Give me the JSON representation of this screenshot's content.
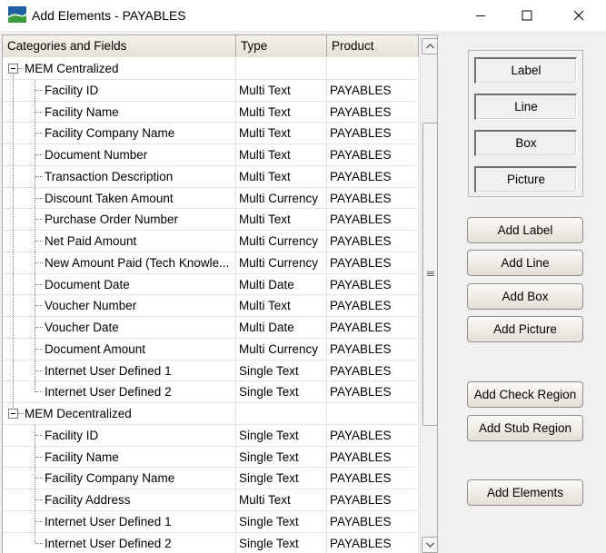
{
  "window": {
    "title": "Add Elements - PAYABLES"
  },
  "grid": {
    "columns": [
      "Categories and Fields",
      "Type",
      "Product"
    ],
    "categories": [
      {
        "name": "MEM Centralized",
        "fields": [
          {
            "name": "Facility ID",
            "type": "Multi Text",
            "product": "PAYABLES"
          },
          {
            "name": "Facility Name",
            "type": "Multi Text",
            "product": "PAYABLES"
          },
          {
            "name": "Facility Company Name",
            "type": "Multi Text",
            "product": "PAYABLES"
          },
          {
            "name": "Document Number",
            "type": "Multi Text",
            "product": "PAYABLES"
          },
          {
            "name": "Transaction Description",
            "type": "Multi Text",
            "product": "PAYABLES"
          },
          {
            "name": "Discount Taken Amount",
            "type": "Multi Currency",
            "product": "PAYABLES"
          },
          {
            "name": "Purchase Order Number",
            "type": "Multi Text",
            "product": "PAYABLES"
          },
          {
            "name": "Net Paid Amount",
            "type": "Multi Currency",
            "product": "PAYABLES"
          },
          {
            "name": "New Amount Paid (Tech Knowle...",
            "type": "Multi Currency",
            "product": "PAYABLES"
          },
          {
            "name": "Document Date",
            "type": "Multi Date",
            "product": "PAYABLES"
          },
          {
            "name": "Voucher Number",
            "type": "Multi Text",
            "product": "PAYABLES"
          },
          {
            "name": "Voucher Date",
            "type": "Multi Date",
            "product": "PAYABLES"
          },
          {
            "name": "Document Amount",
            "type": "Multi Currency",
            "product": "PAYABLES"
          },
          {
            "name": "Internet User Defined 1",
            "type": "Single Text",
            "product": "PAYABLES"
          },
          {
            "name": "Internet User Defined 2",
            "type": "Single Text",
            "product": "PAYABLES"
          }
        ]
      },
      {
        "name": "MEM Decentralized",
        "fields": [
          {
            "name": "Facility ID",
            "type": "Single Text",
            "product": "PAYABLES"
          },
          {
            "name": "Facility Name",
            "type": "Single Text",
            "product": "PAYABLES"
          },
          {
            "name": "Facility Company Name",
            "type": "Single Text",
            "product": "PAYABLES"
          },
          {
            "name": "Facility Address",
            "type": "Multi Text",
            "product": "PAYABLES"
          },
          {
            "name": "Internet User Defined 1",
            "type": "Single Text",
            "product": "PAYABLES"
          },
          {
            "name": "Internet User Defined 2",
            "type": "Single Text",
            "product": "PAYABLES"
          }
        ]
      }
    ]
  },
  "palette": {
    "items": [
      "Label",
      "Line",
      "Box",
      "Picture"
    ]
  },
  "buttons": {
    "add_label": "Add Label",
    "add_line": "Add Line",
    "add_box": "Add Box",
    "add_picture": "Add Picture",
    "add_check_region": "Add Check Region",
    "add_stub_region": "Add Stub Region",
    "add_elements": "Add Elements"
  },
  "icons": {
    "app": "app-logo-icon",
    "minimize": "minimize-icon",
    "maximize": "maximize-icon",
    "close": "close-icon",
    "scroll_up": "chevron-up-icon",
    "scroll_down": "chevron-down-icon",
    "expander": "collapse-minus-icon"
  },
  "colors": {
    "header_bg": "#ebe6dc",
    "panel_bg": "#f0f0f0",
    "logo_blue": "#1f5fa6",
    "logo_green": "#3c9a3c"
  }
}
